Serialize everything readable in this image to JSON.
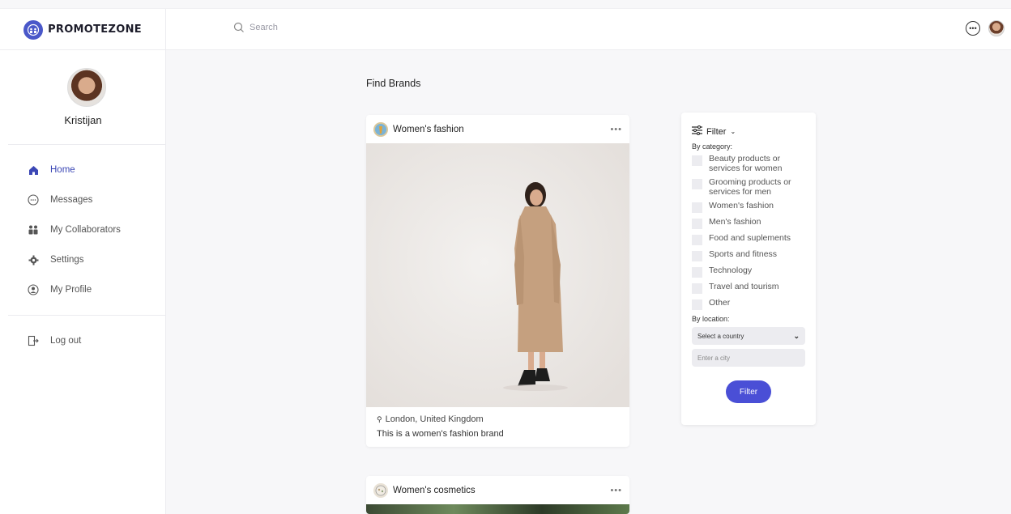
{
  "brand": {
    "name": "PROMOTEZONE",
    "logo_icon": "globe-people-icon"
  },
  "search": {
    "placeholder": "Search"
  },
  "user": {
    "name": "Kristijan"
  },
  "nav": [
    {
      "label": "Home",
      "icon": "home-icon"
    },
    {
      "label": "Messages",
      "icon": "chat-icon"
    },
    {
      "label": "My Collaborators",
      "icon": "people-icon"
    },
    {
      "label": "Settings",
      "icon": "gear-icon"
    },
    {
      "label": "My Profile",
      "icon": "user-circle-icon"
    }
  ],
  "logout": {
    "label": "Log out",
    "icon": "logout-icon"
  },
  "main": {
    "title": "Find Brands"
  },
  "cards": [
    {
      "category": "Women's fashion",
      "location": "London, United Kingdom",
      "description": "This is a women's fashion brand"
    },
    {
      "category": "Women's cosmetics"
    }
  ],
  "filter": {
    "title": "Filter",
    "by_category": "By category:",
    "categories": [
      "Beauty products or services for women",
      "Grooming products or services for men",
      "Women's fashion",
      "Men's fashion",
      "Food and suplements",
      "Sports and fitness",
      "Technology",
      "Travel and tourism",
      "Other"
    ],
    "by_location": "By location:",
    "country_select": "Select a country",
    "city_placeholder": "Enter a city",
    "button": "Filter"
  },
  "colors": {
    "accent": "#4a4fd6",
    "nav_active": "#3b47b5"
  }
}
